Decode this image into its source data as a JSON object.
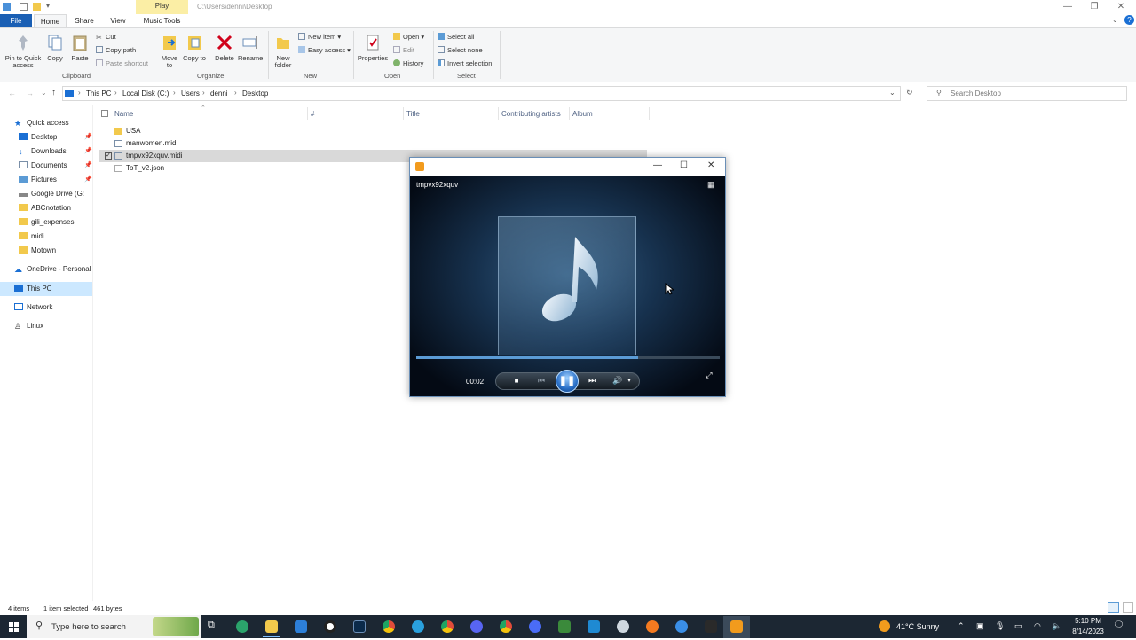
{
  "window": {
    "context_tab": "Play",
    "path": "C:\\Users\\denni\\Desktop"
  },
  "ribbon_tabs": [
    "File",
    "Home",
    "Share",
    "View",
    "Music Tools"
  ],
  "ribbon": {
    "clipboard": {
      "pin": "Pin to Quick access",
      "copy": "Copy",
      "paste": "Paste",
      "cut": "Cut",
      "copy_path": "Copy path",
      "paste_shortcut": "Paste shortcut",
      "label": "Clipboard"
    },
    "organize": {
      "move_to": "Move to",
      "copy_to": "Copy to",
      "delete": "Delete",
      "rename": "Rename",
      "label": "Organize"
    },
    "new": {
      "new_folder": "New folder",
      "new_item": "New item ▾",
      "easy_access": "Easy access ▾",
      "label": "New"
    },
    "open": {
      "properties": "Properties",
      "open": "Open ▾",
      "edit": "Edit",
      "history": "History",
      "label": "Open"
    },
    "select": {
      "select_all": "Select all",
      "select_none": "Select none",
      "invert": "Invert selection",
      "label": "Select"
    }
  },
  "breadcrumb": [
    "This PC",
    "Local Disk (C:)",
    "Users",
    "denni",
    "Desktop"
  ],
  "search": {
    "placeholder": "Search Desktop"
  },
  "nav": {
    "quick_access": "Quick access",
    "items": [
      "Desktop",
      "Downloads",
      "Documents",
      "Pictures",
      "Google Drive (G:",
      "ABCnotation",
      "gili_expenses",
      "midi",
      "Motown"
    ],
    "onedrive": "OneDrive - Personal",
    "this_pc": "This PC",
    "network": "Network",
    "linux": "Linux"
  },
  "columns": [
    "Name",
    "#",
    "Title",
    "Contributing artists",
    "Album"
  ],
  "files": [
    {
      "name": "USA",
      "type": "folder"
    },
    {
      "name": "manwomen.mid",
      "type": "midi"
    },
    {
      "name": "tmpvx92xquv.midi",
      "type": "midi",
      "selected": true
    },
    {
      "name": "ToT_v2.json",
      "type": "file"
    }
  ],
  "status": {
    "items": "4 items",
    "selected": "1 item selected",
    "size": "461 bytes"
  },
  "player": {
    "track": "tmpvx92xquv",
    "time": "00:02",
    "progress": 0.73
  },
  "taskbar": {
    "search_placeholder": "Type here to search",
    "weather": "41°C  Sunny",
    "time": "5:10 PM",
    "date": "8/14/2023"
  },
  "colors": {
    "accent": "#1a5fb4",
    "ribbon_bg": "#f5f6f7",
    "context_tab": "#fbeea5",
    "taskbar": "#1c2733",
    "player_progress": "#5b9bd5"
  }
}
